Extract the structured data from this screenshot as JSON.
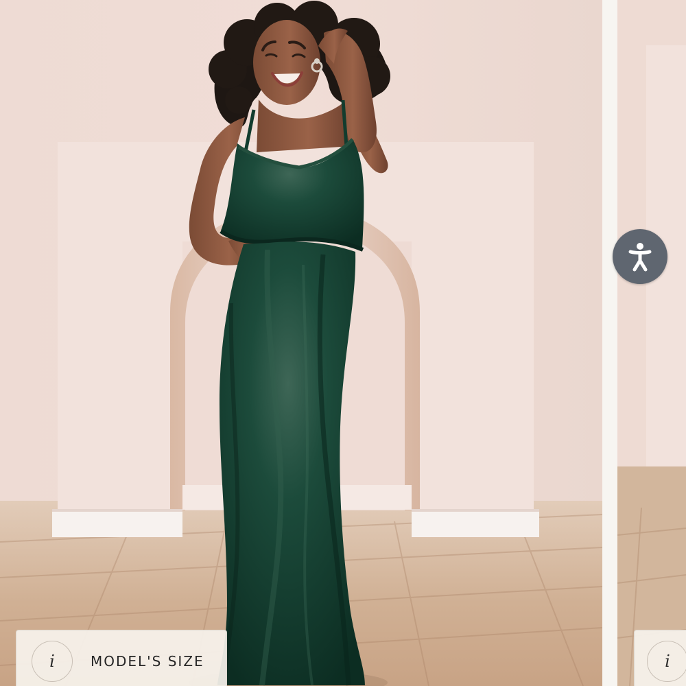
{
  "gallery": {
    "main_image_alt": "Model wearing a long green velvet flounce dress",
    "next_image_alt": "Next product image preview",
    "size_button": {
      "label": "MODEL'S SIZE",
      "info_symbol": "i"
    },
    "secondary_size_button": {
      "info_symbol": "i"
    }
  },
  "accessibility": {
    "icon": "accessibility-person-icon",
    "button_color": "#5f6670"
  },
  "colors": {
    "wall": "#eedbd3",
    "floor": "#c9a98b",
    "dress": "#123c2e",
    "card": "#f6f2ec"
  }
}
